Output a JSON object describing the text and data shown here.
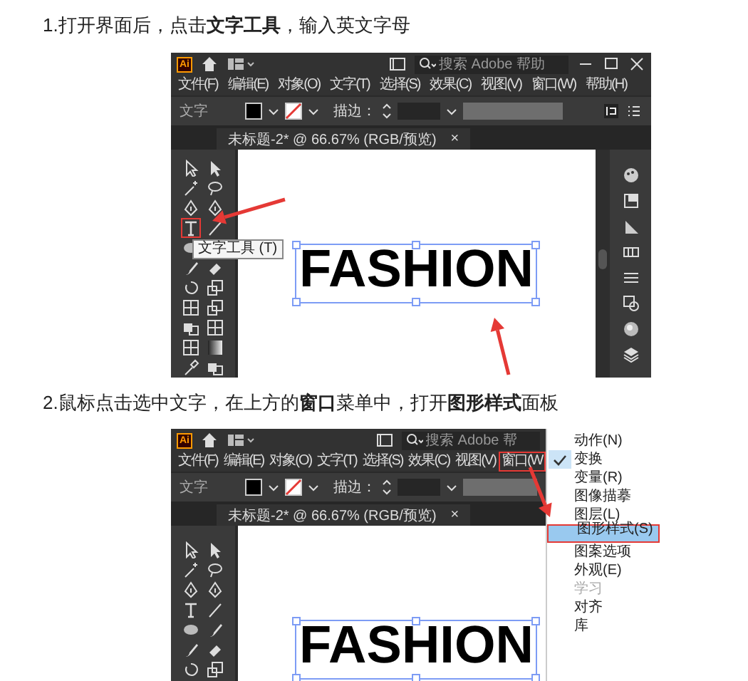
{
  "steps": [
    {
      "caption": "1.打开界面后，点击**文字工具**，输入英文字母",
      "app": {
        "logo": "Ai",
        "search_placeholder": "搜索 Adobe 帮助",
        "window_controls": true,
        "menus": [
          {
            "label": "文件(F)",
            "highlighted": false
          },
          {
            "label": "编辑(E)",
            "highlighted": false
          },
          {
            "label": "对象(O)",
            "highlighted": false
          },
          {
            "label": "文字(T)",
            "highlighted": false
          },
          {
            "label": "选择(S)",
            "highlighted": false
          },
          {
            "label": "效果(C)",
            "highlighted": false
          },
          {
            "label": "视图(V)",
            "highlighted": false
          },
          {
            "label": "窗口(W)",
            "highlighted": false
          },
          {
            "label": "帮助(H)",
            "highlighted": false
          }
        ],
        "control_label": "文字",
        "stroke_label": "描边：",
        "tab_title": "未标题-2* @ 66.67% (RGB/预览)",
        "tab_close": "×",
        "type_tool_highlighted": true,
        "tooltip": "文字工具 (T)",
        "canvas_text": "FASHION",
        "right_panel": true
      }
    },
    {
      "caption": "2.鼠标点击选中文字，在上方的**窗口**菜单中，打开**图形样式**面板",
      "app": {
        "logo": "Ai",
        "search_placeholder": "搜索 Adobe 帮",
        "window_controls": false,
        "menus": [
          {
            "label": "文件(F)",
            "highlighted": false
          },
          {
            "label": "编辑(E)",
            "highlighted": false
          },
          {
            "label": "对象(O)",
            "highlighted": false
          },
          {
            "label": "文字(T)",
            "highlighted": false
          },
          {
            "label": "选择(S)",
            "highlighted": false
          },
          {
            "label": "效果(C)",
            "highlighted": false
          },
          {
            "label": "视图(V)",
            "highlighted": false
          },
          {
            "label": "窗口(W",
            "highlighted": true
          }
        ],
        "control_label": "文字",
        "stroke_label": "描边：",
        "tab_title": "未标题-2* @ 66.67% (RGB/预览)",
        "tab_close": "×",
        "type_tool_highlighted": false,
        "canvas_text": "FASHION",
        "right_panel": false,
        "dropdown": [
          {
            "label": "动作(N)",
            "checked": false,
            "selected": false,
            "disabled": false
          },
          {
            "label": "变换",
            "checked": true,
            "selected": false,
            "disabled": false
          },
          {
            "label": "变量(R)",
            "checked": false,
            "selected": false,
            "disabled": false
          },
          {
            "label": "图像描摹",
            "checked": false,
            "selected": false,
            "disabled": false
          },
          {
            "label": "图层(L)",
            "checked": false,
            "selected": false,
            "disabled": false
          },
          {
            "label": "图形样式(S)",
            "checked": false,
            "selected": true,
            "disabled": false
          },
          {
            "label": "图案选项",
            "checked": false,
            "selected": false,
            "disabled": false
          },
          {
            "label": "外观(E)",
            "checked": false,
            "selected": false,
            "disabled": false
          },
          {
            "label": "学习",
            "checked": false,
            "selected": false,
            "disabled": true
          },
          {
            "label": "对齐",
            "checked": false,
            "selected": false,
            "disabled": false
          },
          {
            "label": "库",
            "checked": false,
            "selected": false,
            "disabled": false
          }
        ]
      }
    }
  ]
}
